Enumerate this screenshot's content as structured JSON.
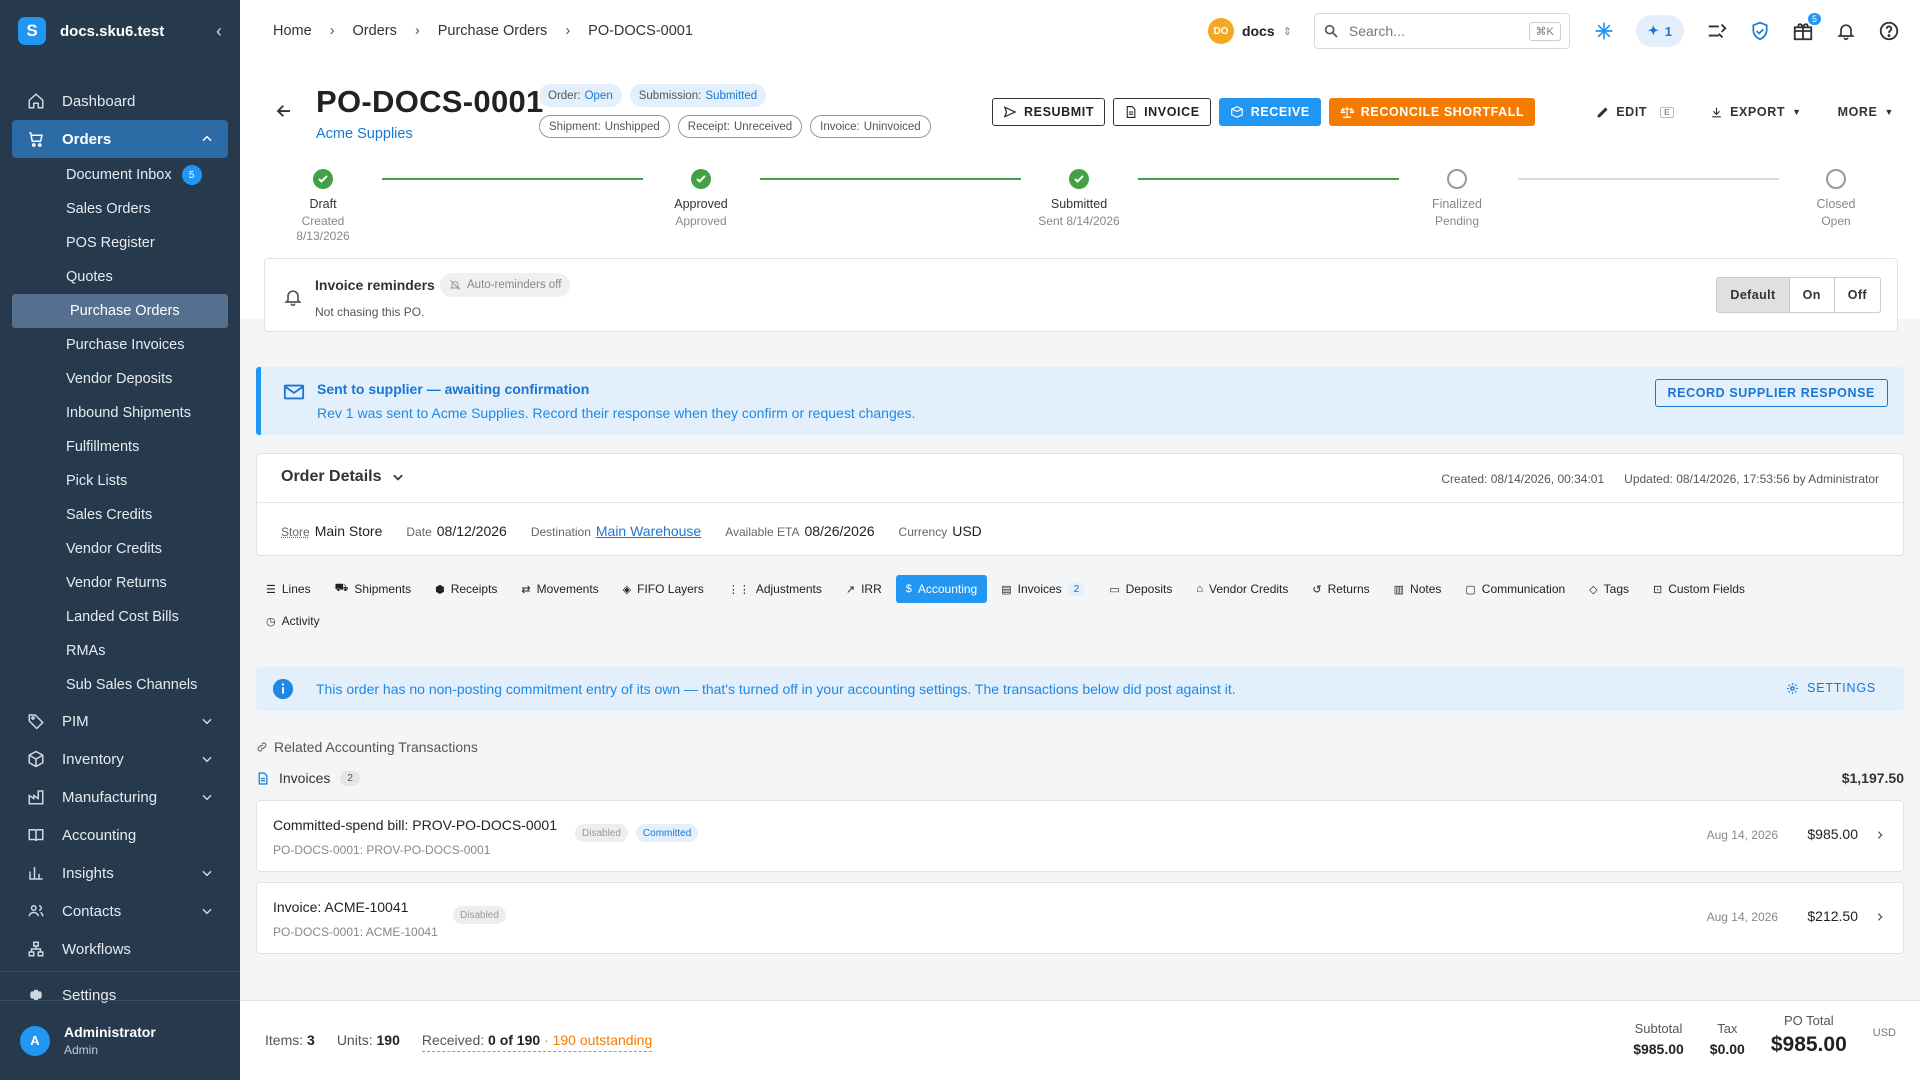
{
  "app": {
    "title": "docs.sku6.test"
  },
  "sidebar": {
    "items": [
      {
        "label": "Dashboard"
      },
      {
        "label": "Orders"
      },
      {
        "label": "PIM"
      },
      {
        "label": "Inventory"
      },
      {
        "label": "Manufacturing"
      },
      {
        "label": "Accounting"
      },
      {
        "label": "Insights"
      },
      {
        "label": "Contacts"
      },
      {
        "label": "Workflows"
      },
      {
        "label": "Settings"
      }
    ],
    "orders_sub": [
      {
        "label": "Document Inbox",
        "badge": "5"
      },
      {
        "label": "Sales Orders"
      },
      {
        "label": "POS Register"
      },
      {
        "label": "Quotes"
      },
      {
        "label": "Purchase Orders"
      },
      {
        "label": "Purchase Invoices"
      },
      {
        "label": "Vendor Deposits"
      },
      {
        "label": "Inbound Shipments"
      },
      {
        "label": "Fulfillments"
      },
      {
        "label": "Pick Lists"
      },
      {
        "label": "Sales Credits"
      },
      {
        "label": "Vendor Credits"
      },
      {
        "label": "Vendor Returns"
      },
      {
        "label": "Landed Cost Bills"
      },
      {
        "label": "RMAs"
      },
      {
        "label": "Sub Sales Channels"
      }
    ],
    "user": {
      "name": "Administrator",
      "role": "Admin",
      "initial": "A"
    }
  },
  "topbar": {
    "breadcrumb": [
      "Home",
      "Orders",
      "Purchase Orders",
      "PO-DOCS-0001"
    ],
    "org_initials": "DO",
    "org_name": "docs",
    "search_placeholder": "Search...",
    "search_shortcut": "⌘K",
    "ai_count": "1",
    "gift_count": "5"
  },
  "po": {
    "number": "PO-DOCS-0001",
    "vendor": "Acme Supplies",
    "chips": {
      "order_k": "Order:",
      "order_v": "Open",
      "submission_k": "Submission:",
      "submission_v": "Submitted",
      "shipment_k": "Shipment:",
      "shipment_v": "Unshipped",
      "receipt_k": "Receipt:",
      "receipt_v": "Unreceived",
      "invoice_k": "Invoice:",
      "invoice_v": "Uninvoiced"
    },
    "actions": {
      "resubmit": "RESUBMIT",
      "invoice": "INVOICE",
      "receive": "RECEIVE",
      "reconcile": "RECONCILE SHORTFALL",
      "edit": "EDIT",
      "edit_key": "E",
      "export": "EXPORT",
      "more": "MORE"
    }
  },
  "steps": [
    {
      "title": "Draft",
      "sub1": "Created",
      "sub2": "8/13/2026",
      "done": true
    },
    {
      "title": "Approved",
      "sub1": "Approved",
      "sub2": "",
      "done": true
    },
    {
      "title": "Submitted",
      "sub1": "Sent 8/14/2026",
      "sub2": "",
      "done": true
    },
    {
      "title": "Finalized",
      "sub1": "Pending",
      "sub2": "",
      "done": false
    },
    {
      "title": "Closed",
      "sub1": "Open",
      "sub2": "",
      "done": false
    }
  ],
  "reminders": {
    "title": "Invoice reminders",
    "chip": "Auto-reminders off",
    "sub": "Not chasing this PO.",
    "options": [
      "Default",
      "On",
      "Off"
    ]
  },
  "sent_banner": {
    "title": "Sent to supplier — awaiting confirmation",
    "text": "Rev 1 was sent to Acme Supplies. Record their response when they confirm or request changes.",
    "button": "RECORD SUPPLIER RESPONSE"
  },
  "order_details": {
    "title": "Order Details",
    "created": "Created: 08/14/2026, 00:34:01",
    "updated": "Updated: 08/14/2026, 17:53:56 by Administrator",
    "store_k": "Store",
    "store_v": "Main Store",
    "date_k": "Date",
    "date_v": "08/12/2026",
    "dest_k": "Destination",
    "dest_v": "Main Warehouse",
    "eta_k": "Available ETA",
    "eta_v": "08/26/2026",
    "cur_k": "Currency",
    "cur_v": "USD"
  },
  "tabs": {
    "row1": [
      {
        "label": "Lines",
        "icon": "list-icon"
      },
      {
        "label": "Shipments",
        "icon": "truck-icon"
      },
      {
        "label": "Receipts",
        "icon": "box-icon"
      },
      {
        "label": "Movements",
        "icon": "arrows-icon"
      },
      {
        "label": "FIFO Layers",
        "icon": "layers-icon"
      },
      {
        "label": "Adjustments",
        "icon": "sliders-icon"
      },
      {
        "label": "IRR",
        "icon": "trend-icon"
      },
      {
        "label": "Accounting",
        "icon": "dollar-icon",
        "active": true
      },
      {
        "label": "Invoices",
        "icon": "document-icon",
        "count": "2"
      },
      {
        "label": "Deposits",
        "icon": "cash-icon"
      },
      {
        "label": "Vendor Credits",
        "icon": "bank-icon"
      },
      {
        "label": "Returns",
        "icon": "return-icon"
      },
      {
        "label": "Notes",
        "icon": "note-icon"
      },
      {
        "label": "Communication",
        "icon": "chat-icon"
      },
      {
        "label": "Tags",
        "icon": "tag-icon"
      },
      {
        "label": "Custom Fields",
        "icon": "fields-icon"
      }
    ],
    "row2": [
      {
        "label": "Activity",
        "icon": "history-icon"
      }
    ]
  },
  "accounting": {
    "info": "This order has no non-posting commitment entry of its own — that's turned off in your accounting settings. The transactions below did post against it.",
    "settings": "SETTINGS",
    "related": "Related Accounting Transactions",
    "invoices_label": "Invoices",
    "invoices_count": "2",
    "invoices_total": "$1,197.50",
    "rows": [
      {
        "title": "Committed-spend bill: PROV-PO-DOCS-0001",
        "sub": "PO-DOCS-0001: PROV-PO-DOCS-0001",
        "tag1": "Disabled",
        "tag2": "Committed",
        "date": "Aug 14, 2026",
        "amount": "$985.00"
      },
      {
        "title": "Invoice: ACME-10041",
        "sub": "PO-DOCS-0001: ACME-10041",
        "tag1": "Disabled",
        "date": "Aug 14, 2026",
        "amount": "$212.50"
      }
    ]
  },
  "footer": {
    "items_k": "Items:",
    "items_v": "3",
    "units_k": "Units:",
    "units_v": "190",
    "received_k": "Received:",
    "received_v": "0 of 190",
    "outstanding": "· 190 outstanding",
    "subtotal_k": "Subtotal",
    "subtotal_v": "$985.00",
    "tax_k": "Tax",
    "tax_v": "$0.00",
    "total_k": "PO Total",
    "total_v": "$985.00",
    "currency": "USD"
  }
}
